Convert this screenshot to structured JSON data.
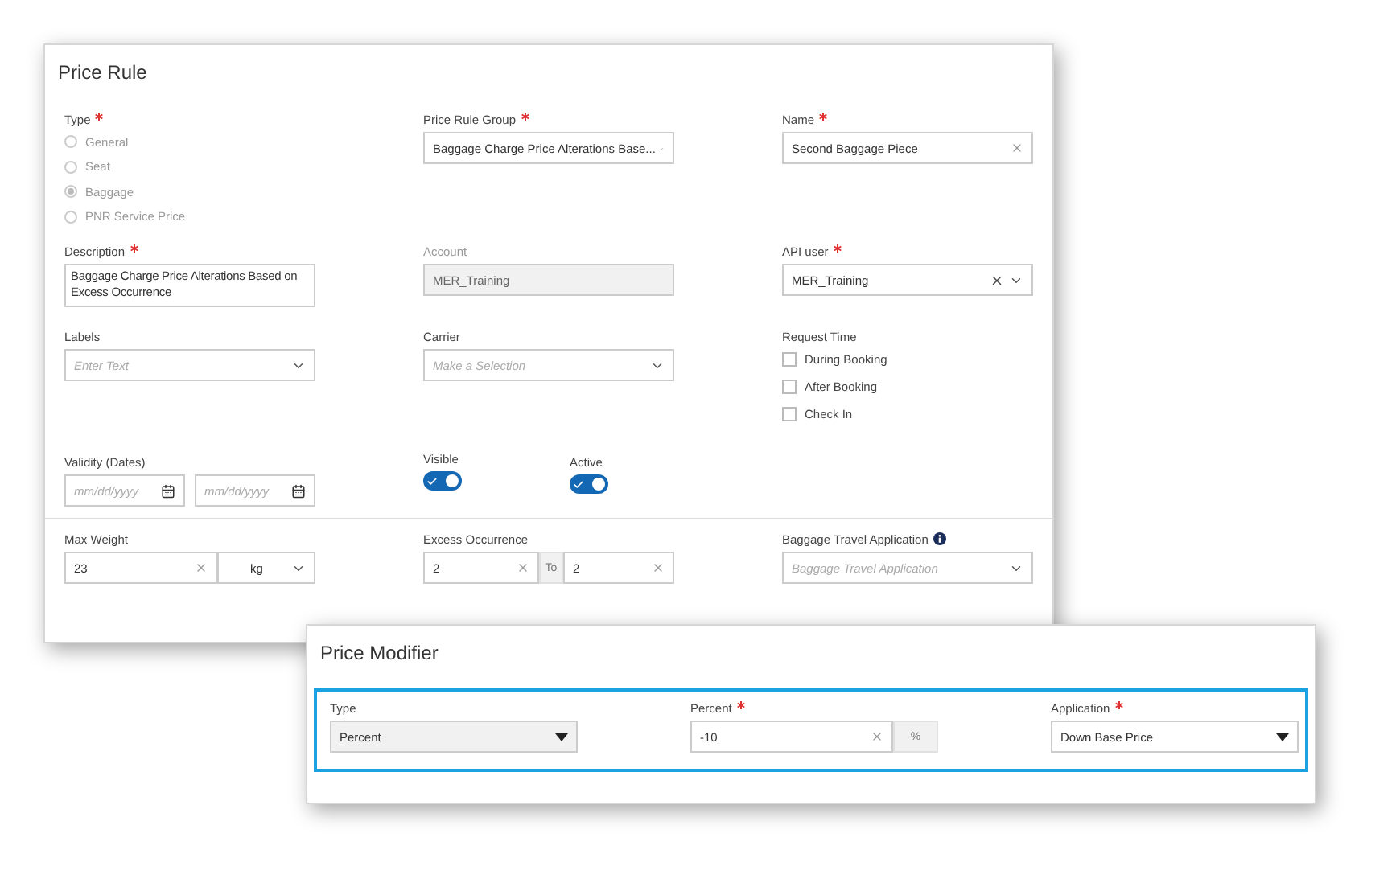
{
  "price_rule": {
    "title": "Price Rule",
    "type": {
      "label": "Type",
      "required": true,
      "options": [
        {
          "label": "General",
          "selected": false
        },
        {
          "label": "Seat",
          "selected": false
        },
        {
          "label": "Baggage",
          "selected": true
        },
        {
          "label": "PNR Service Price",
          "selected": false
        }
      ]
    },
    "price_rule_group": {
      "label": "Price Rule Group",
      "required": true,
      "value": "Baggage Charge Price Alterations Base..."
    },
    "name": {
      "label": "Name",
      "required": true,
      "value": "Second Baggage Piece"
    },
    "description": {
      "label": "Description",
      "required": true,
      "value": "Baggage Charge Price Alterations Based on Excess Occurrence"
    },
    "account": {
      "label": "Account",
      "required": false,
      "value": "MER_Training",
      "disabled": true
    },
    "api_user": {
      "label": "API user",
      "required": true,
      "value": "MER_Training"
    },
    "labels": {
      "label": "Labels",
      "placeholder": "Enter Text"
    },
    "carrier": {
      "label": "Carrier",
      "placeholder": "Make a Selection"
    },
    "request_time": {
      "label": "Request Time",
      "options": [
        {
          "label": "During Booking",
          "checked": false
        },
        {
          "label": "After Booking",
          "checked": false
        },
        {
          "label": "Check In",
          "checked": false
        }
      ]
    },
    "validity": {
      "label": "Validity (Dates)",
      "from_placeholder": "mm/dd/yyyy",
      "to_placeholder": "mm/dd/yyyy"
    },
    "visible": {
      "label": "Visible",
      "on": true
    },
    "active": {
      "label": "Active",
      "on": true
    },
    "max_weight": {
      "label": "Max Weight",
      "value": "23",
      "unit": "kg"
    },
    "excess_occurrence": {
      "label": "Excess Occurrence",
      "from": "2",
      "separator": "To",
      "to": "2"
    },
    "baggage_travel_application": {
      "label": "Baggage Travel Application",
      "placeholder": "Baggage Travel Application"
    }
  },
  "price_modifier": {
    "title": "Price Modifier",
    "type": {
      "label": "Type",
      "required": false,
      "value": "Percent"
    },
    "percent": {
      "label": "Percent",
      "required": true,
      "value": "-10",
      "unit": "%"
    },
    "application": {
      "label": "Application",
      "required": true,
      "value": "Down Base Price"
    }
  }
}
